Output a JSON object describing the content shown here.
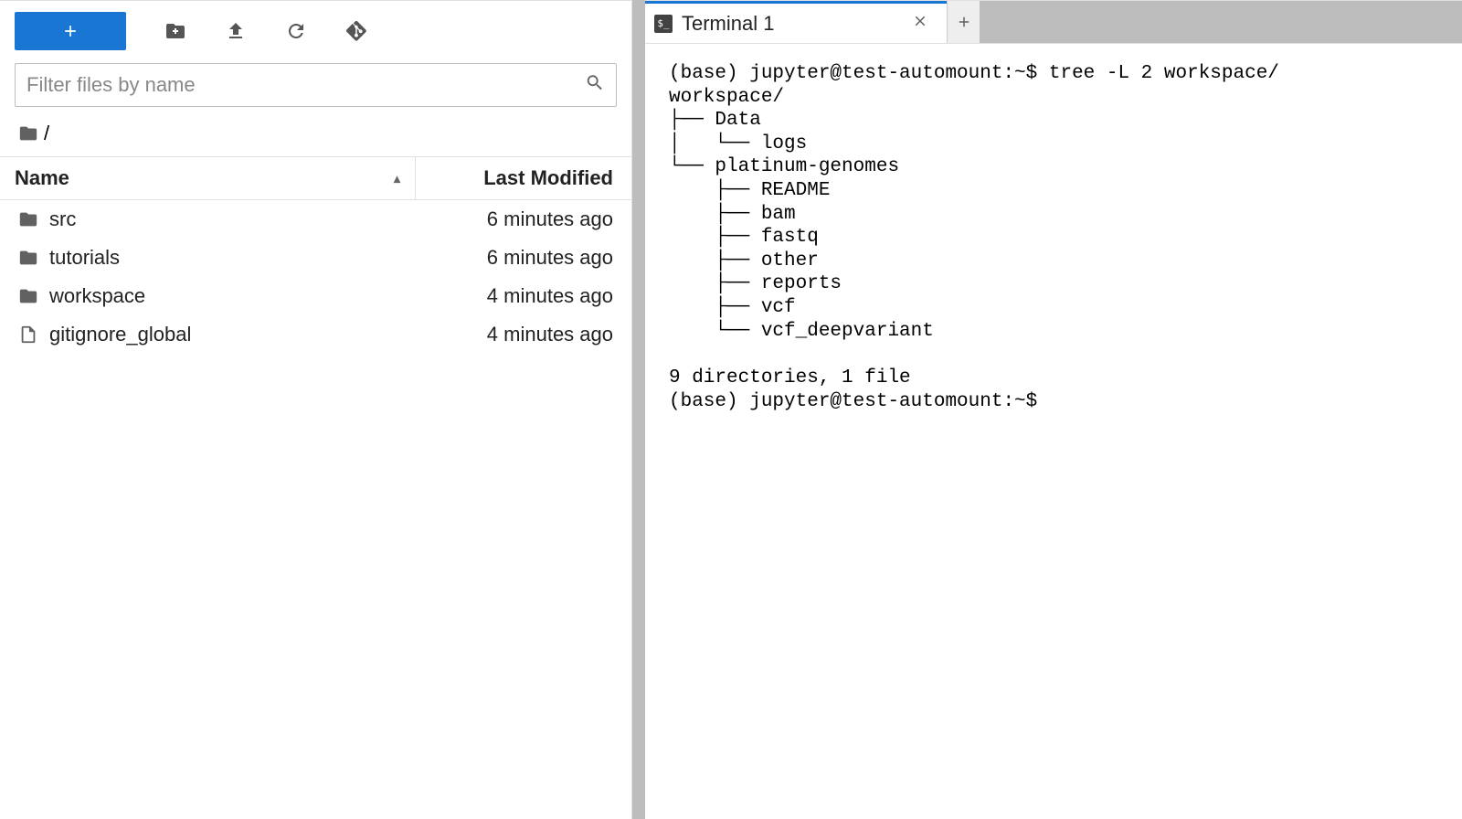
{
  "toolbar": {
    "new_button_label": "+",
    "icons": [
      "new-folder",
      "upload",
      "refresh",
      "git"
    ]
  },
  "filter": {
    "placeholder": "Filter files by name",
    "value": ""
  },
  "breadcrumb": {
    "path": "/"
  },
  "columns": {
    "name": "Name",
    "modified": "Last Modified",
    "sort_indicator": "▴"
  },
  "files": [
    {
      "type": "folder",
      "name": "src",
      "modified": "6 minutes ago"
    },
    {
      "type": "folder",
      "name": "tutorials",
      "modified": "6 minutes ago"
    },
    {
      "type": "folder",
      "name": "workspace",
      "modified": "4 minutes ago"
    },
    {
      "type": "file",
      "name": "gitignore_global",
      "modified": "4 minutes ago"
    }
  ],
  "tab": {
    "label": "Terminal 1",
    "icon_text": "$_"
  },
  "terminal": {
    "lines": [
      "(base) jupyter@test-automount:~$ tree -L 2 workspace/",
      "workspace/",
      "├── Data",
      "│   └── logs",
      "└── platinum-genomes",
      "    ├── README",
      "    ├── bam",
      "    ├── fastq",
      "    ├── other",
      "    ├── reports",
      "    ├── vcf",
      "    └── vcf_deepvariant",
      "",
      "9 directories, 1 file",
      "(base) jupyter@test-automount:~$ "
    ]
  }
}
